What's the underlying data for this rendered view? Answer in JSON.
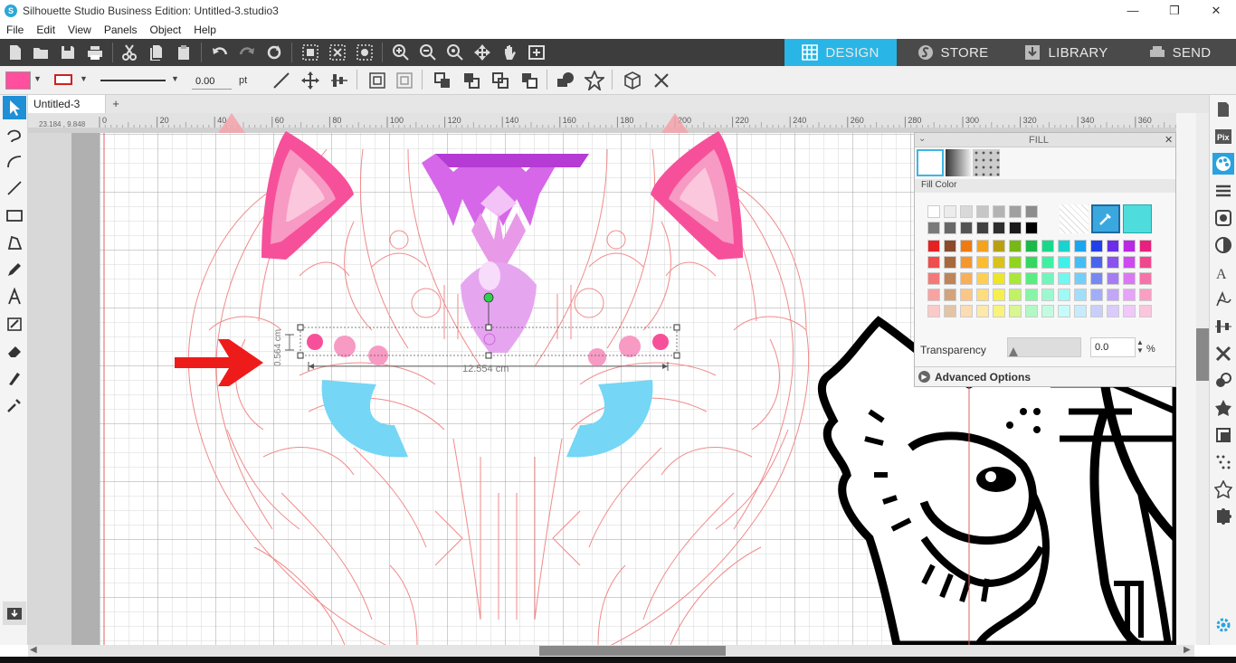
{
  "window": {
    "title": "Silhouette Studio Business Edition: Untitled-3.studio3",
    "minimize": "—",
    "maximize": "❐",
    "close": "✕"
  },
  "menu": [
    "File",
    "Edit",
    "View",
    "Panels",
    "Object",
    "Help"
  ],
  "nav_tabs": [
    {
      "label": "DESIGN",
      "active": true,
      "icon": "grid-icon"
    },
    {
      "label": "STORE",
      "active": false,
      "icon": "silhouette-s-icon"
    },
    {
      "label": "LIBRARY",
      "active": false,
      "icon": "library-icon"
    },
    {
      "label": "SEND",
      "active": false,
      "icon": "printer-send-icon"
    }
  ],
  "line_toolbar": {
    "fill_color": "#ff4f9e",
    "line_color": "#cc2222",
    "line_width_value": "0.00",
    "line_width_unit": "pt"
  },
  "document_tab": {
    "label": "Untitled-3",
    "add": "+"
  },
  "coordinate_readout": "23.184 , 9.848",
  "ruler": {
    "ticks": [
      "0",
      "20",
      "40",
      "60",
      "80",
      "100",
      "120",
      "140",
      "160",
      "180",
      "200",
      "220",
      "240",
      "260",
      "280",
      "300",
      "320",
      "340",
      "360"
    ]
  },
  "canvas": {
    "selection_width": "12.554 cm",
    "selection_height": "0.564 cm"
  },
  "fill_panel": {
    "title": "FILL",
    "section": "Fill Color",
    "transparency_label": "Transparency",
    "transparency_value": "0.0",
    "transparency_unit": "%",
    "advanced": "Advanced Options",
    "grays": [
      "#ffffff",
      "#ececec",
      "#d9d9d9",
      "#c6c6c6",
      "#b3b3b3",
      "#a0a0a0",
      "#8d8d8d"
    ],
    "grays2": [
      "#7a7a7a",
      "#676767",
      "#545454",
      "#414141",
      "#2e2e2e",
      "#1b1b1b",
      "#000000"
    ],
    "colors": [
      [
        "#e52222",
        "#8b4a2b",
        "#f07a12",
        "#f5a21c",
        "#b8a012",
        "#76b816",
        "#1cb84a",
        "#18d88c",
        "#1ad3cf",
        "#1aa6ef",
        "#2240e8",
        "#6a2ee8",
        "#b928e2",
        "#e8207e"
      ],
      [
        "#f04d4d",
        "#a8683e",
        "#f5962e",
        "#ffbc2e",
        "#d9c21b",
        "#90d41e",
        "#34d860",
        "#3ef0a2",
        "#3ef0ea",
        "#43bdf5",
        "#4a63ef",
        "#8a52ef",
        "#cc4aef",
        "#f0478f"
      ],
      [
        "#f57878",
        "#bd8559",
        "#f9ae58",
        "#ffcf52",
        "#ede52a",
        "#a9e83a",
        "#58ed81",
        "#6ff7bb",
        "#72f7f1",
        "#73cff8",
        "#7788f3",
        "#a67cf3",
        "#da78f3",
        "#f573a8"
      ],
      [
        "#f9a2a2",
        "#d1a47d",
        "#fbc687",
        "#ffdc7e",
        "#f6f04f",
        "#c1f264",
        "#86f5a5",
        "#9cf9cf",
        "#9ff9f5",
        "#a0dffa",
        "#a1aef7",
        "#c2a6f7",
        "#e6a3f7",
        "#f89fc2"
      ],
      [
        "#fcc9c9",
        "#e3c4a6",
        "#fddcb3",
        "#ffe9aa",
        "#f9f37d",
        "#d8f792",
        "#b2f8c6",
        "#c3fbe1",
        "#c5fbf9",
        "#c6ecfc",
        "#c7cffa",
        "#dacbfa",
        "#f0c9fa",
        "#fbc6db"
      ]
    ],
    "selected_swatch": "#4fdcdc"
  }
}
